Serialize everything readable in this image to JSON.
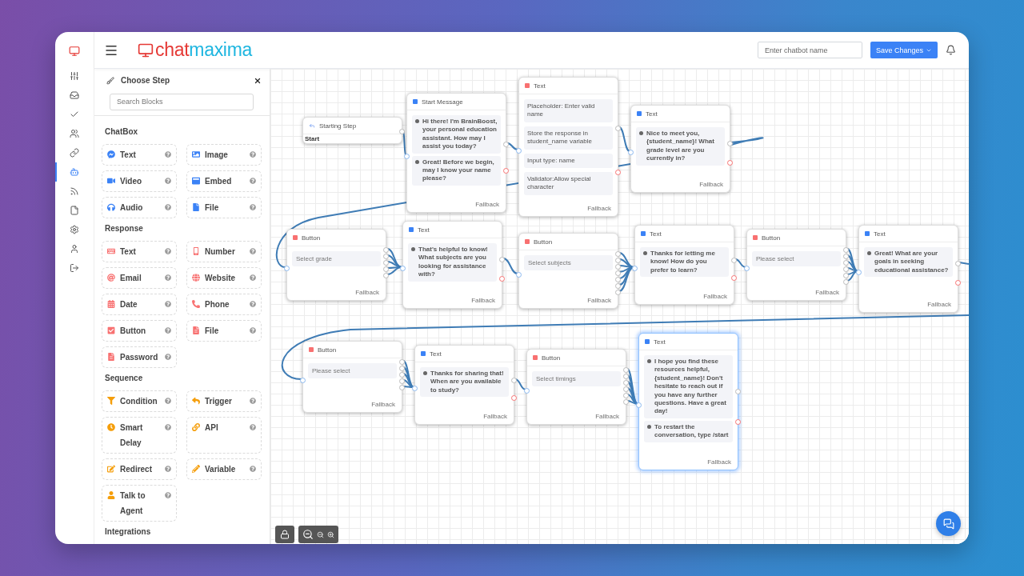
{
  "rail": [
    {
      "selected": false
    },
    {
      "selected": false
    },
    {
      "selected": false
    },
    {
      "selected": false
    },
    {
      "selected": false
    },
    {
      "selected": true
    },
    {
      "selected": false
    },
    {
      "selected": false
    },
    {
      "selected": false
    },
    {
      "selected": false
    },
    {
      "selected": false
    }
  ],
  "logo": {
    "part1": "chat",
    "part2": "maxima"
  },
  "topbar": {
    "name_placeholder": "Enter chatbot name",
    "save": "Save Changes"
  },
  "panel": {
    "title": "Choose Step",
    "search_placeholder": "Search Blocks",
    "sections": [
      {
        "title": "ChatBox",
        "color": "#3b82f6",
        "items": [
          "Text",
          "Image",
          "Video",
          "Embed",
          "Audio",
          "File"
        ]
      },
      {
        "title": "Response",
        "color": "#f87171",
        "items": [
          "Text",
          "Number",
          "Email",
          "Website",
          "Date",
          "Phone",
          "Button",
          "File",
          "Password"
        ]
      },
      {
        "title": "Sequence",
        "color": "#f59e0b",
        "items": [
          "Condition",
          "Trigger",
          "Smart Delay",
          "API",
          "Redirect",
          "Variable",
          "Talk to Agent"
        ]
      },
      {
        "title": "Integrations"
      }
    ]
  },
  "nodes": [
    {
      "kind": "start",
      "title": "Starting Step",
      "note": "Start",
      "selected": false
    },
    {
      "kind": "message",
      "title": "Start Message",
      "messages": [
        "Hi there! I'm BrainBoost, your personal education assistant. How may I assist you today?",
        "Great! Before we begin, may I know your name please?"
      ],
      "fallback": "Fallback",
      "selected": false
    },
    {
      "kind": "input",
      "title": "Text",
      "fields": [
        "Placeholder: Enter valid name",
        "Store the response in student_name variable",
        "Input type: name",
        "Validator:Allow special character"
      ],
      "fallback": "Fallback",
      "selected": false
    },
    {
      "kind": "message",
      "title": "Text",
      "messages": [
        "Nice to meet you, {student_name}! What grade level are you currently in?"
      ],
      "fallback": "Fallback",
      "selected": false
    },
    {
      "kind": "button",
      "title": "Button",
      "prompt": "Select grade",
      "fallback": "Fallback",
      "selected": false
    },
    {
      "kind": "message",
      "title": "Text",
      "messages": [
        "That's helpful to know! What subjects are you looking for assistance with?"
      ],
      "fallback": "Fallback",
      "selected": false
    },
    {
      "kind": "button",
      "title": "Button",
      "prompt": "Select subjects",
      "fallback": "Fallback",
      "selected": false
    },
    {
      "kind": "message",
      "title": "Text",
      "messages": [
        "Thanks for letting me know! How do you prefer to learn?"
      ],
      "fallback": "Fallback",
      "selected": false
    },
    {
      "kind": "button",
      "title": "Button",
      "prompt": "Please select",
      "fallback": "Fallback",
      "selected": false
    },
    {
      "kind": "message",
      "title": "Text",
      "messages": [
        "Great! What are your goals in seeking educational assistance?"
      ],
      "fallback": "Fallback",
      "selected": false
    },
    {
      "kind": "button",
      "title": "Button",
      "prompt": "Please select",
      "fallback": "Fallback",
      "selected": false
    },
    {
      "kind": "message",
      "title": "Text",
      "messages": [
        "Thanks for sharing that! When are you available to study?"
      ],
      "fallback": "Fallback",
      "selected": false
    },
    {
      "kind": "button",
      "title": "Button",
      "prompt": "Select timings",
      "fallback": "Fallback",
      "selected": false
    },
    {
      "kind": "message",
      "title": "Text",
      "messages": [
        "I hope you find these resources helpful, {student_name}! Don't hesitate to reach out if you have any further questions. Have a great day!",
        "To restart the conversation, type /start"
      ],
      "fallback": "Fallback",
      "selected": true
    }
  ]
}
